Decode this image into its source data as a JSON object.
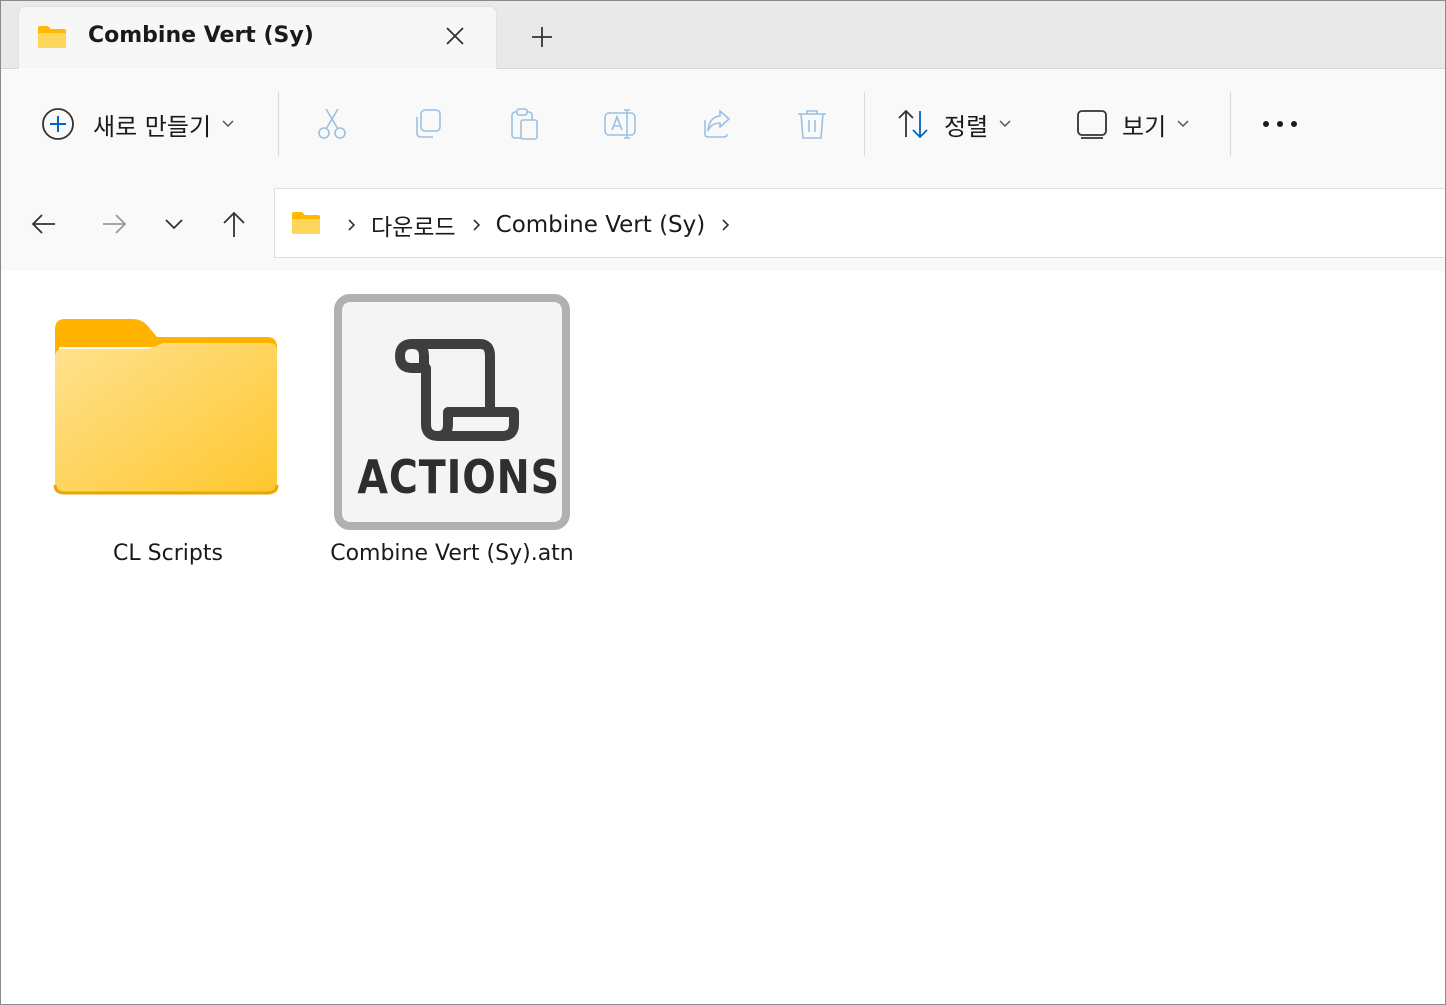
{
  "tab": {
    "title": "Combine Vert (Sy)"
  },
  "toolbar": {
    "new_label": "새로 만들기",
    "sort_label": "정렬",
    "view_label": "보기"
  },
  "breadcrumb": [
    "다운로드",
    "Combine Vert (Sy)"
  ],
  "items": [
    {
      "name": "CL Scripts",
      "type": "folder"
    },
    {
      "name": "Combine Vert (Sy).atn",
      "type": "file",
      "icon_text": "ACTIONS"
    }
  ],
  "colors": {
    "folder": "#ffc83d",
    "accent": "#0067c0",
    "disabled_icon": "#9bc0e2"
  }
}
